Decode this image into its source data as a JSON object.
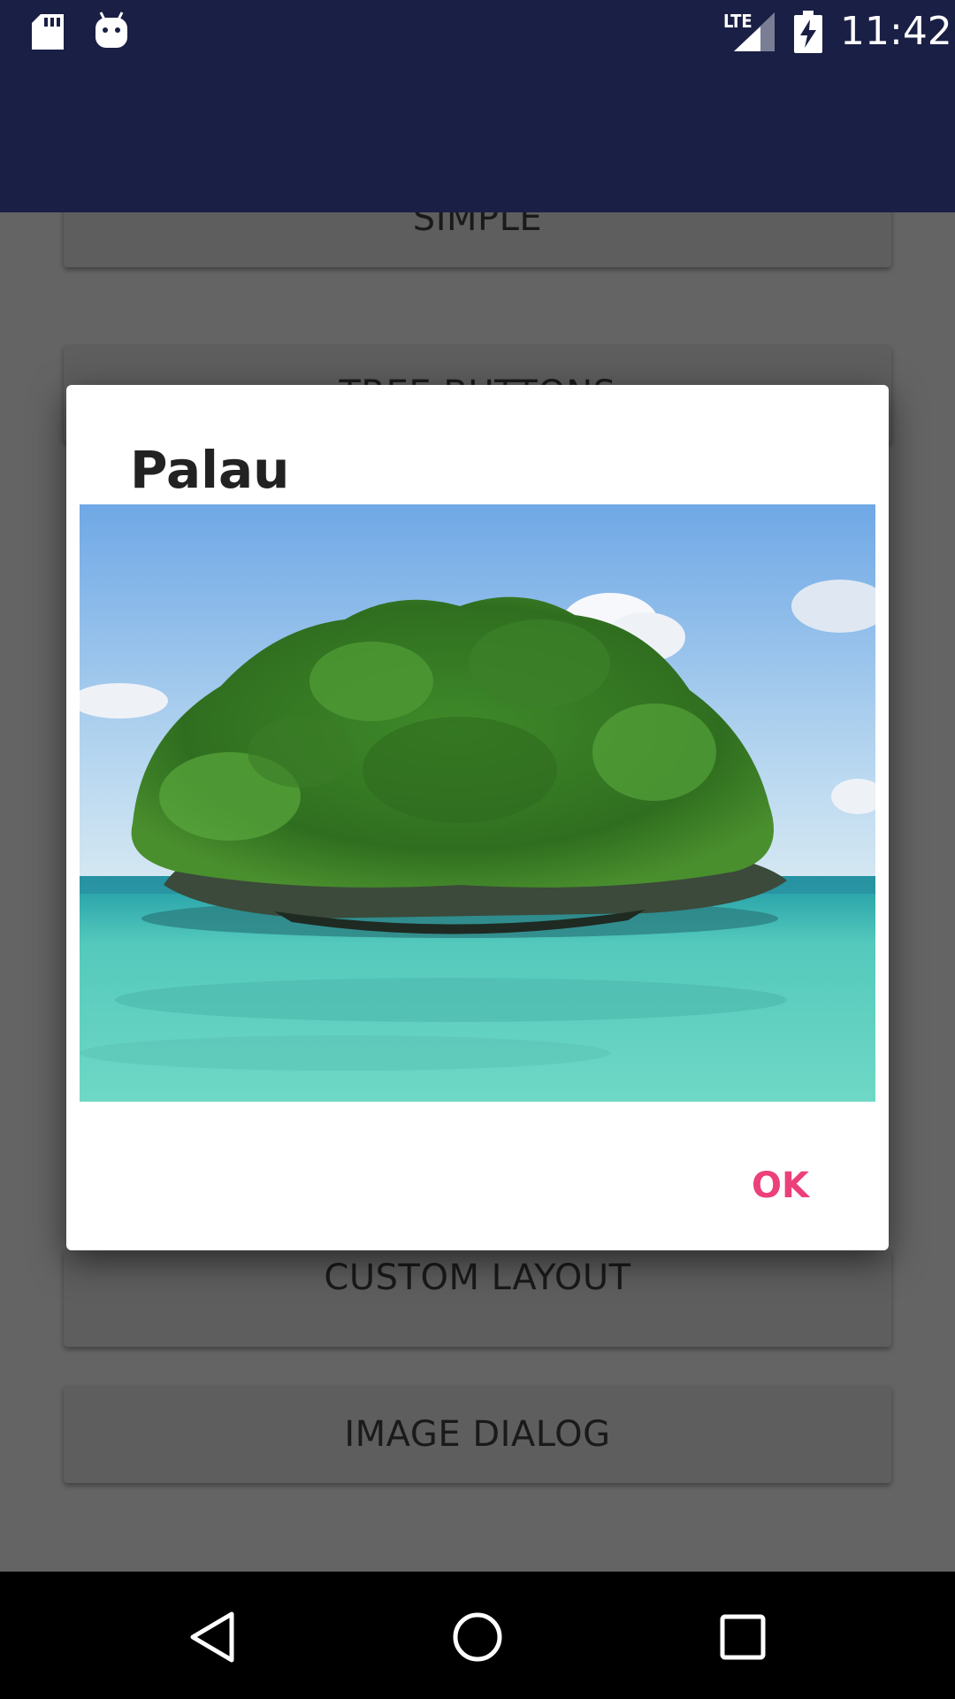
{
  "status_bar": {
    "time": "11:42",
    "network_label": "LTE",
    "icons": [
      "sd-card-icon",
      "android-icon",
      "signal-icon",
      "battery-charging-icon"
    ]
  },
  "background_buttons": {
    "simple_label": "SIMPLE",
    "three_buttons_label": "TREE BUTTONS",
    "custom_layout_label": "CUSTOM LAYOUT",
    "image_dialog_label": "IMAGE DIALOG"
  },
  "dialog": {
    "title": "Palau",
    "image_icon": "island-photo",
    "ok_label": "OK"
  },
  "nav_bar": {
    "icons": [
      "back-icon",
      "home-icon",
      "recents-icon"
    ]
  },
  "colors": {
    "primary": "#1a1f45",
    "accent": "#ec407a",
    "scrim": "#646464"
  }
}
